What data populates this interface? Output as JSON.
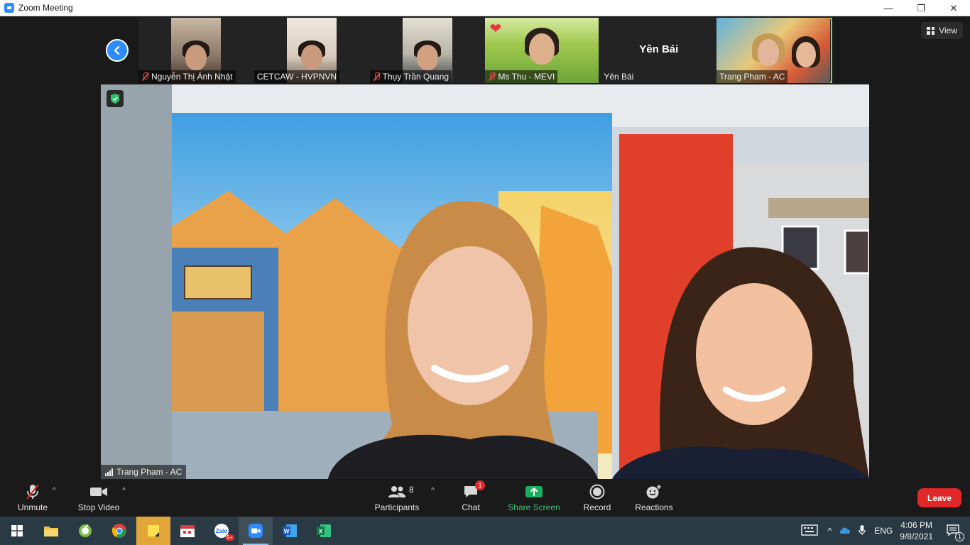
{
  "window": {
    "title": "Zoom Meeting",
    "buttons": {
      "minimize": "—",
      "maximize": "❐",
      "close": "✕"
    }
  },
  "view_button": {
    "label": "View"
  },
  "thumbnails": [
    {
      "name": "Nguyễn Thị Ánh Nhật",
      "muted": true
    },
    {
      "name": "CETCAW - HVPNVN",
      "muted": false
    },
    {
      "name": "Thụy Trần Quang",
      "muted": true
    },
    {
      "name": "Ms Thu - MEVI",
      "muted": true,
      "reaction": "❤"
    },
    {
      "name": "Yên Bái",
      "muted": false,
      "center_label": "Yên Bái"
    },
    {
      "name": "Trang Pham - AC",
      "muted": false,
      "active": true
    }
  ],
  "main_video": {
    "speaker_name": "Trang Pham - AC"
  },
  "controls": {
    "unmute": "Unmute",
    "stop_video": "Stop Video",
    "participants": "Participants",
    "participants_count": "8",
    "chat": "Chat",
    "chat_badge": "1",
    "share_screen": "Share Screen",
    "record": "Record",
    "reactions": "Reactions",
    "leave": "Leave"
  },
  "taskbar": {
    "apps": [
      "windows-start",
      "file-explorer",
      "greenshot",
      "chrome",
      "sticky-notes",
      "calendar-app",
      "zalo",
      "zoom",
      "word",
      "excel"
    ],
    "zalo_badge": "5+",
    "language": "ENG",
    "time": "4:06 PM",
    "date": "9/8/2021",
    "notifications": "1"
  },
  "colors": {
    "zoom_blue": "#2d8cff",
    "share_green": "#1aaf5d",
    "leave_red": "#e02828",
    "active_outline": "#8ad46f"
  }
}
